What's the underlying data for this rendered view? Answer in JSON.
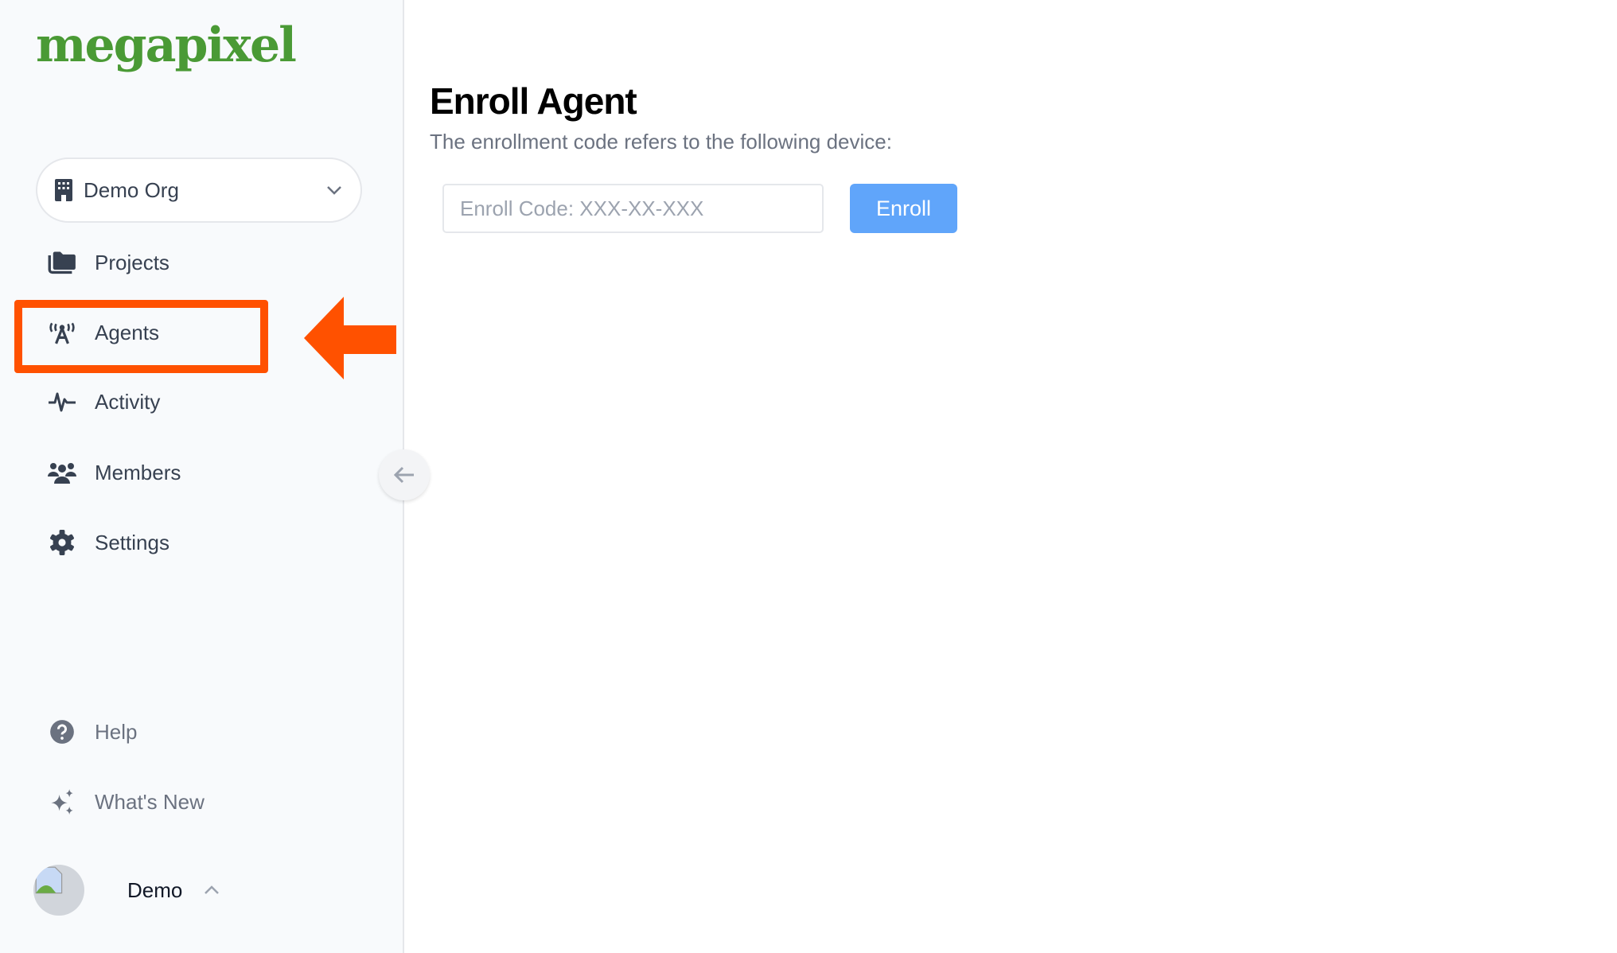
{
  "sidebar": {
    "logo": "megapixel",
    "org_selector": {
      "label": "Demo Org"
    },
    "nav": [
      {
        "label": "Projects",
        "icon": "folder-icon"
      },
      {
        "label": "Agents",
        "icon": "antenna-icon"
      },
      {
        "label": "Activity",
        "icon": "pulse-icon"
      },
      {
        "label": "Members",
        "icon": "users-icon"
      },
      {
        "label": "Settings",
        "icon": "gear-icon"
      }
    ],
    "footer": [
      {
        "label": "Help",
        "icon": "question-circle-icon"
      },
      {
        "label": "What's New",
        "icon": "sparkles-icon"
      }
    ],
    "user": {
      "name": "Demo"
    }
  },
  "main": {
    "title": "Enroll Agent",
    "subtitle": "The enrollment code refers to the following device:",
    "enroll_input": {
      "value": "",
      "placeholder": "Enroll Code: XXX-XX-XXX"
    },
    "enroll_button": "Enroll"
  },
  "annotation": {
    "highlighted_item": "Agents",
    "color": "#ff5100"
  },
  "colors": {
    "brand": "#4a9a35",
    "primary": "#60a5fa",
    "annotation": "#ff5100"
  }
}
